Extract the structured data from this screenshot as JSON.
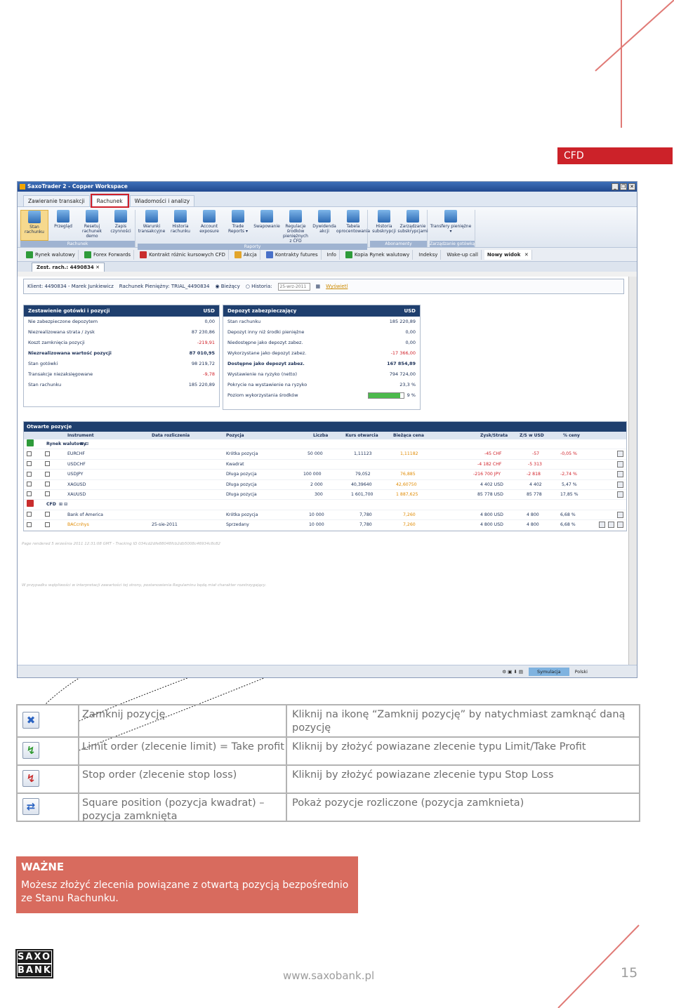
{
  "section_tag": "CFD",
  "app": {
    "window_title": "SaxoTrader 2 - Copper Workspace",
    "window_buttons": [
      "_",
      "❐",
      "✕"
    ],
    "menu_tabs": [
      "Zawieranie transakcji",
      "Rachunek",
      "Wiadomości i analizy"
    ],
    "ribbon_groups": [
      {
        "label": "Rachunek",
        "items": [
          "Stan rachunku",
          "Przegląd",
          "Resetuj rachunek demo",
          "Zapis czynności"
        ]
      },
      {
        "label": "Raporty",
        "items": [
          "Warunki transakcyjne",
          "Historia rachunku",
          "Account exposure",
          "Trade Reports ▾",
          "Swapowanie",
          "Regulacje środków pieniężnych z CFD",
          "Dywidenda akcji",
          "Tabela oprocentowania"
        ]
      },
      {
        "label": "Abonamenty",
        "items": [
          "Historia subskrypcji",
          "Zarządzanie subskrypcjami"
        ]
      },
      {
        "label": "Zarządzanie gotówką",
        "items": [
          "Transfery pieniężne ▾"
        ]
      }
    ],
    "nav_items": [
      "Rynek walutowy",
      "Forex Forwards",
      "Kontrakt różnic kursowych CFD",
      "Akcja",
      "Kontrakty futures",
      "Info",
      "Kopia Rynek walutowy",
      "Indeksy",
      "Wake-up call",
      "Nowy widok"
    ],
    "doc_tab": "Zest. rach.: 4490834",
    "client_bar": {
      "client": "Klient: 4490834 - Marek Junkiewicz",
      "account": "Rachunek Pieniężny: TRIAL_4490834",
      "current": "Bieżący",
      "history": "Historia:",
      "date": "25-wrz-2011",
      "show": "Wyświetl"
    },
    "cash_panel": {
      "title": "Zestawienie gotówki i pozycji",
      "currency": "USD",
      "rows": [
        {
          "label": "Nie zabezpieczone depozytem",
          "value": "0,00"
        },
        {
          "label": "Niezrealizowana strata / zysk",
          "value": "87 230,86"
        },
        {
          "label": "Koszt zamknięcia pozycji",
          "value": "-219,91"
        },
        {
          "label": "Niezrealizowana wartość pozycji",
          "value": "87 010,95"
        },
        {
          "label": "Stan gotówki",
          "value": "98 219,72"
        },
        {
          "label": "Transakcje niezaksięgowane",
          "value": "-9,78"
        },
        {
          "label": "Stan rachunku",
          "value": "185 220,89"
        }
      ]
    },
    "margin_panel": {
      "title": "Depozyt zabezpieczający",
      "currency": "USD",
      "rows": [
        {
          "label": "Stan rachunku",
          "value": "185 220,89"
        },
        {
          "label": "Depozyt inny niż środki pieniężne",
          "value": "0,00"
        },
        {
          "label": "Niedostępne jako depozyt zabez.",
          "value": "0,00"
        },
        {
          "label": "Wykorzystane jako depozyt zabez.",
          "value": "-17 366,00"
        },
        {
          "label": "Dostępne jako depozyt zabez.",
          "value": "167 854,89"
        },
        {
          "label": "Wystawienie na ryzyko (netto)",
          "value": "794 724,00"
        },
        {
          "label": "Pokrycie na wystawienie na ryzyko",
          "value": "23,3 %"
        },
        {
          "label": "Poziom wykorzystania środków",
          "value": "9 %"
        }
      ],
      "usage_fraction": 0.9
    },
    "positions": {
      "title": "Otwarte pozycje",
      "columns": [
        "Instrument",
        "Data rozliczenia",
        "Pozycja",
        "Liczba",
        "Kurs otwarcia",
        "Bieżąca cena",
        "Zysk/Strata",
        "Z/S w USD",
        "% ceny"
      ],
      "group_fx": "Rynek walutowy",
      "group_cfd": "CFD",
      "rows": [
        {
          "instrument": "EURCHF",
          "date": "",
          "position": "Krótka pozycja",
          "amount": "50 000",
          "open": "1,11123",
          "current": "1,11182",
          "pl": "-45 CHF",
          "pl_usd": "-57",
          "pct": "-0,05 %"
        },
        {
          "instrument": "USDCHF",
          "date": "",
          "position": "Kwadrat",
          "amount": "",
          "open": "",
          "current": "",
          "pl": "-4 182 CHF",
          "pl_usd": "-5 313",
          "pct": ""
        },
        {
          "instrument": "USDJPY",
          "date": "",
          "position": "Długa pozycja",
          "amount": "100 000",
          "open": "79,052",
          "current": "76,885",
          "pl": "-216 700 JPY",
          "pl_usd": "-2 818",
          "pct": "-2,74 %"
        },
        {
          "instrument": "XAGUSD",
          "date": "",
          "position": "Długa pozycja",
          "amount": "2 000",
          "open": "40,39640",
          "current": "42,60750",
          "pl": "4 402 USD",
          "pl_usd": "4 402",
          "pct": "5,47 %"
        },
        {
          "instrument": "XAUUSD",
          "date": "",
          "position": "Długa pozycja",
          "amount": "300",
          "open": "1 601,700",
          "current": "1 887,625",
          "pl": "85 778 USD",
          "pl_usd": "85 778",
          "pct": "17,85 %"
        },
        {
          "instrument": "Bank of America",
          "date": "",
          "position": "Krótka pozycja",
          "amount": "10 000",
          "open": "7,780",
          "current": "7,260",
          "pl": "4 800 USD",
          "pl_usd": "4 800",
          "pct": "6,68 %"
        },
        {
          "instrument": "BACcnhys",
          "date": "25-sie-2011",
          "position": "Sprzedany",
          "amount": "10 000",
          "open": "7,780",
          "current": "7,260",
          "pl": "4 800 USD",
          "pl_usd": "4 800",
          "pct": "6,68 %"
        }
      ]
    },
    "footnote_1": "Page rendered 5 września 2011 12:31:08 GMT - Tracking ID 034cd2dfe88048fcb2db5008c46934c8c82",
    "footnote_2": "W przypadku wątpliwości w interpretacji zawartości tej strony, postanowienia Regulaminu będą miał charakter rozstrzygający.",
    "status_sim": "Symulacja",
    "status_lang": "Polski"
  },
  "legend": [
    {
      "icon": "close-position-icon",
      "name": "Zamknij pozycję",
      "desc": "Kliknij na ikonę “Zamknij pozycję” by natychmiast zamknąć daną pozycję"
    },
    {
      "icon": "limit-order-icon",
      "name": "Limit order (zlecenie limit) = Take profit",
      "desc": "Kliknij by złożyć powiazane zlecenie typu Limit/Take Profit"
    },
    {
      "icon": "stop-order-icon",
      "name": "Stop order (zlecenie stop loss)",
      "desc": "Kliknij by złożyć powiazane zlecenie typu Stop Loss"
    },
    {
      "icon": "square-position-icon",
      "name": "Square position (pozycja kwadrat) – pozycja zamknięta",
      "desc": "Pokaż pozycje rozliczone (pozycja zamknieta)"
    }
  ],
  "important": {
    "title": "WAŻNE",
    "body": "Możesz złożyć zlecenia powiązane z otwartą pozycją bezpośrednio ze Stanu Rachunku."
  },
  "logo": {
    "line1": "SAXO",
    "line2": "BANK"
  },
  "url": "www.saxobank.pl",
  "page_number": "15"
}
